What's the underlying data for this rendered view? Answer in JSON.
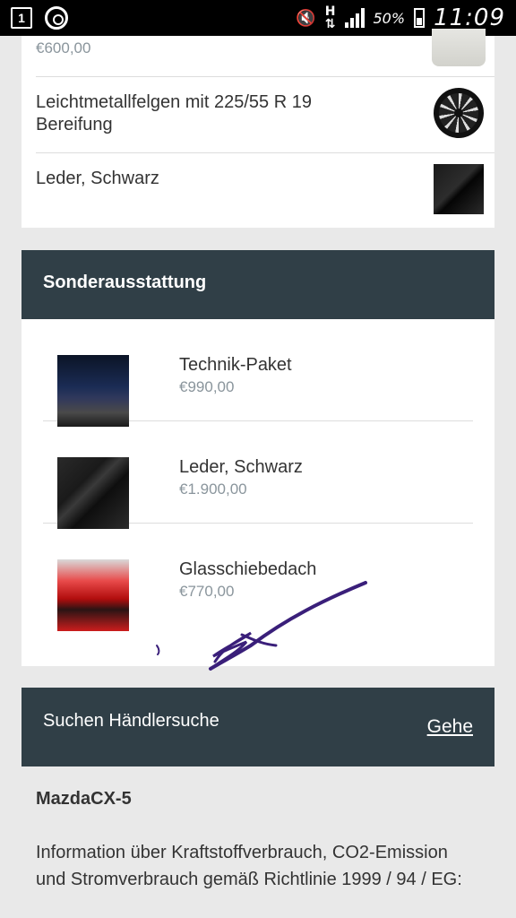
{
  "status_bar": {
    "notification_box": "1",
    "network_type": "H",
    "battery_percent": "50%",
    "time": "11:09",
    "icons": [
      "notification-box-icon",
      "sync-icon",
      "mute-icon",
      "network-h-icon",
      "signal-icon",
      "battery-icon"
    ]
  },
  "standard": {
    "items": [
      {
        "price": "€600,00"
      },
      {
        "label": "Leichtmetallfelgen mit 225/55 R 19 Bereifung"
      },
      {
        "label": "Leder, Schwarz"
      }
    ]
  },
  "sonderausstattung": {
    "title": "Sonderausstattung",
    "items": [
      {
        "name": "Technik-Paket",
        "price": "€990,00"
      },
      {
        "name": "Leder, Schwarz",
        "price": "€1.900,00"
      },
      {
        "name": "Glasschiebedach",
        "price": "€770,00"
      }
    ]
  },
  "dealer": {
    "title": "Suchen Händlersuche",
    "go_label": "Gehe"
  },
  "model": {
    "title": "MazdaCX-5",
    "info": "Information über Kraftstoffverbrauch, CO2-Emission und Stromverbrauch gemäß Richtlinie 1999 / 94 / EG:"
  },
  "colors": {
    "header_bg": "#303f47",
    "price_text": "#8a959c",
    "page_bg": "#e9e9e9",
    "annotation_ink": "#3a1f7a"
  }
}
